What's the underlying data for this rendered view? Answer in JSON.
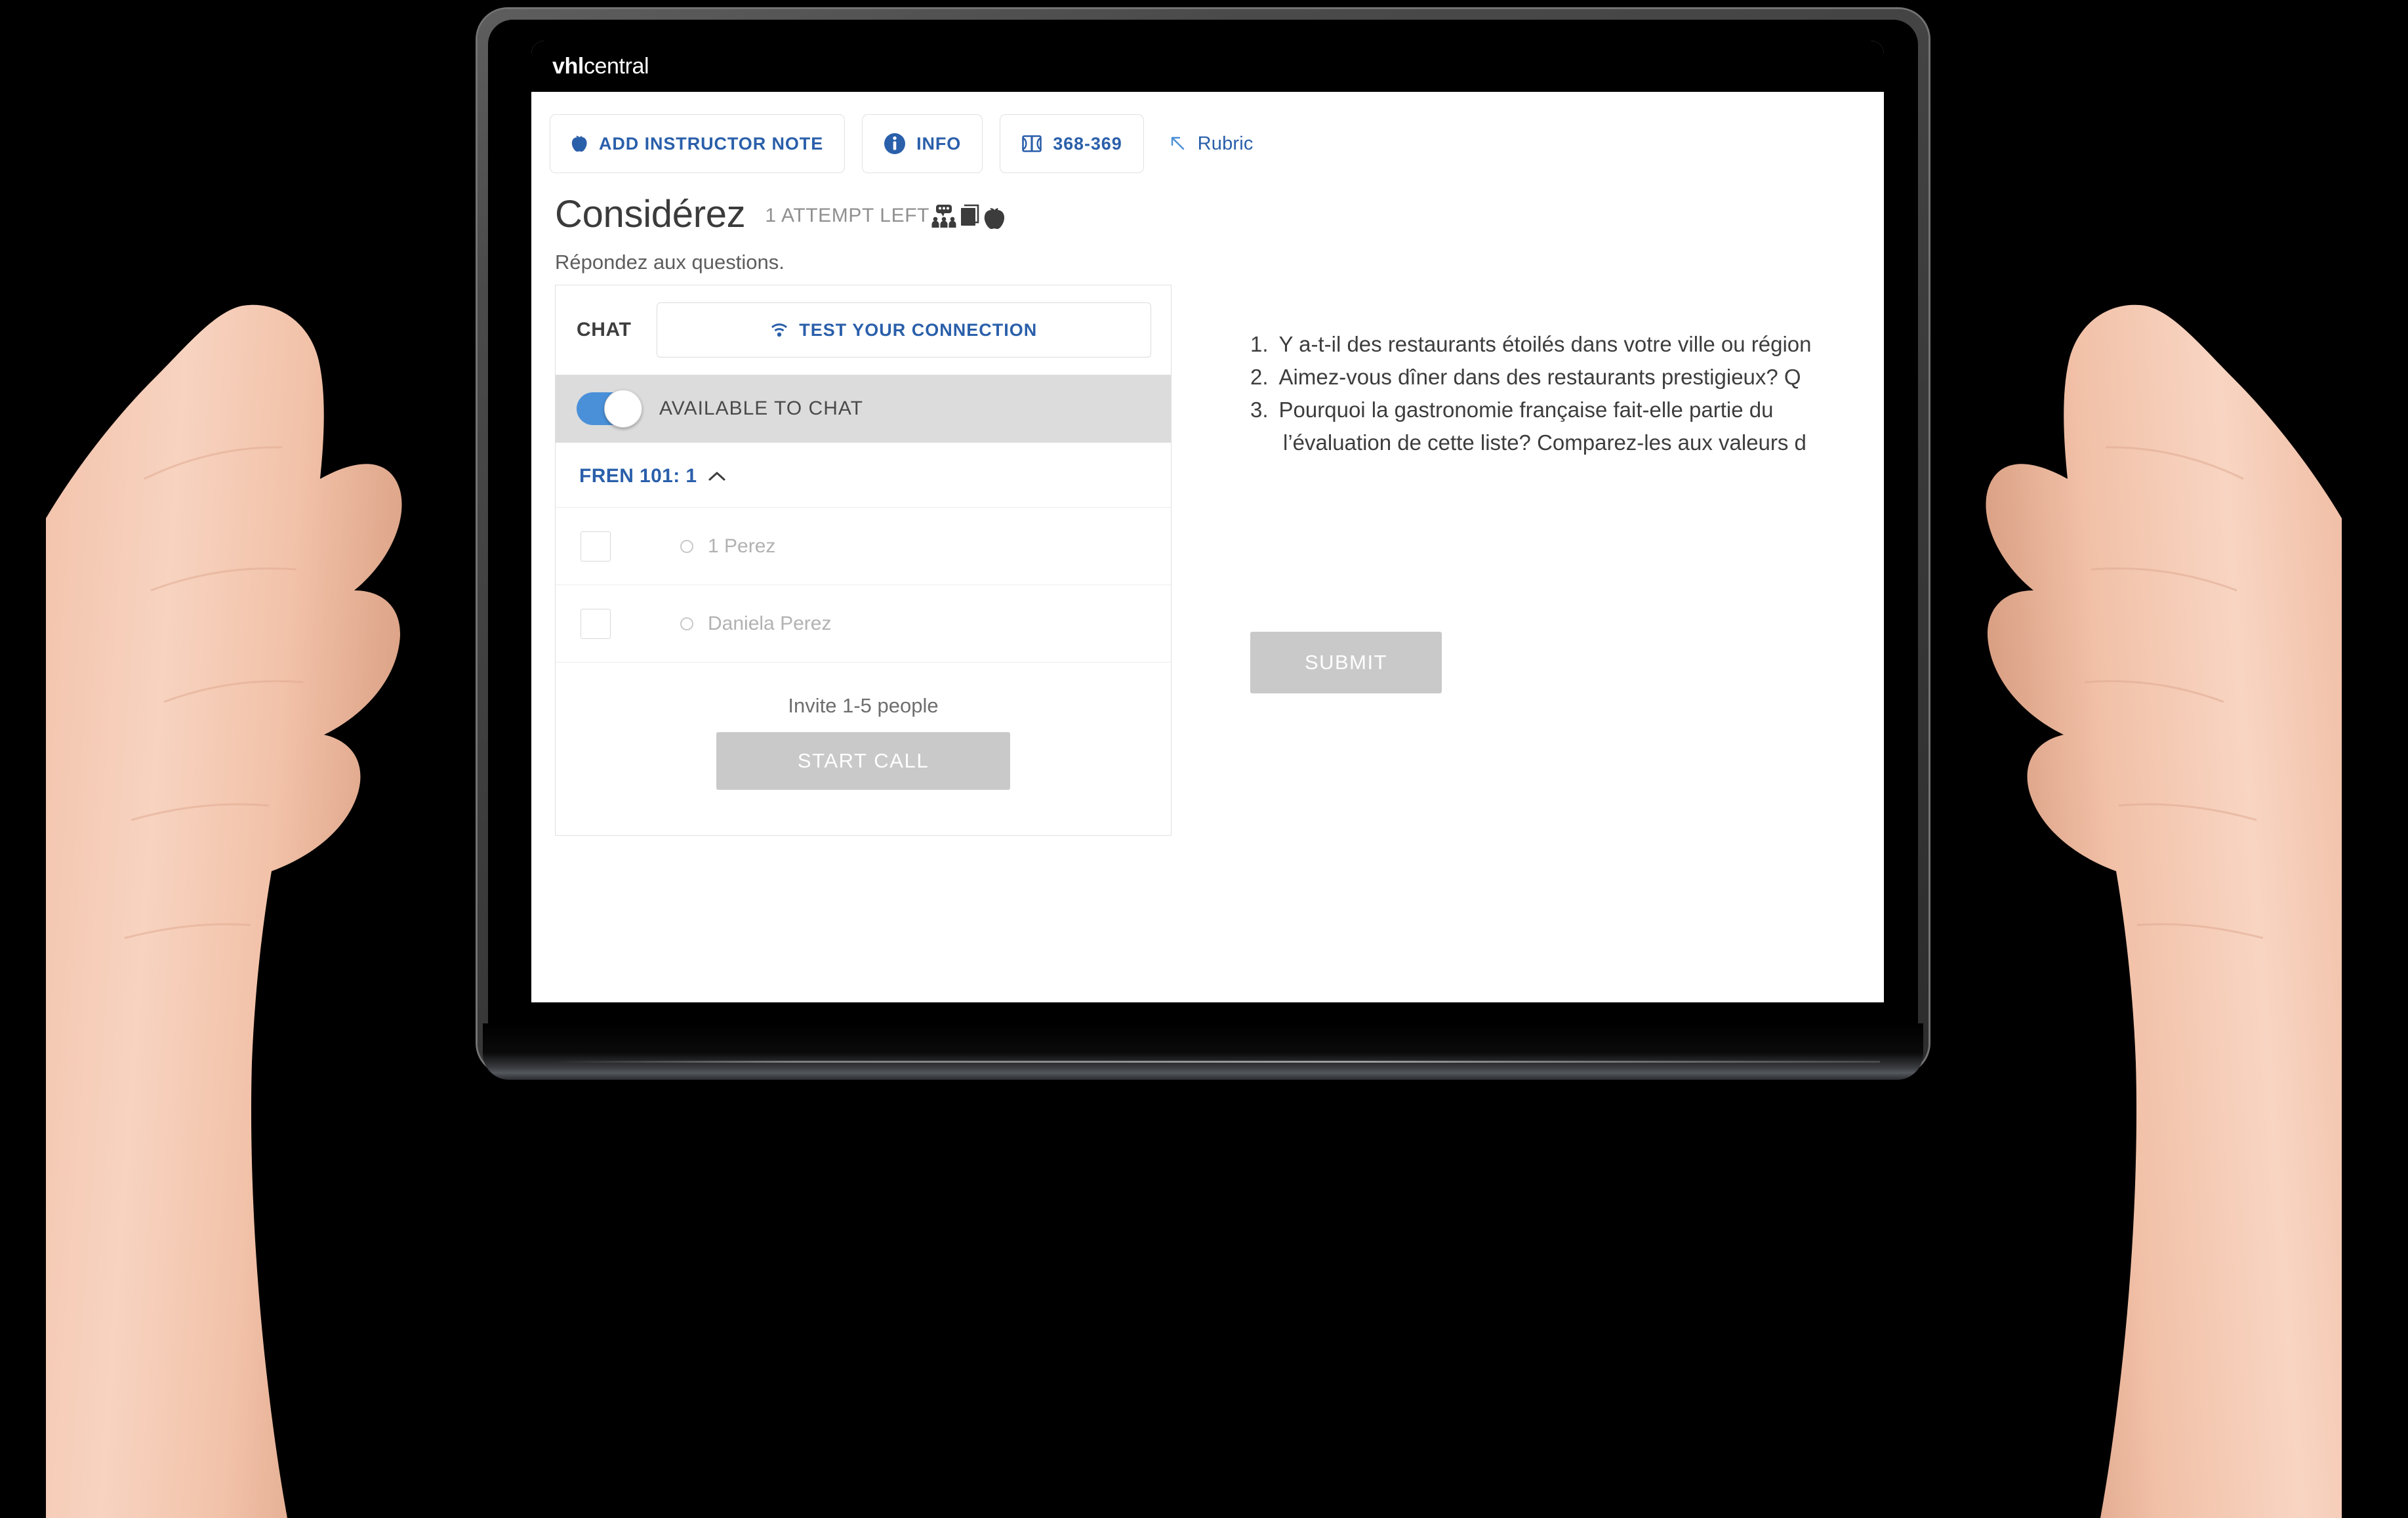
{
  "brand": {
    "bold": "vhl",
    "regular": "central"
  },
  "toolbar": {
    "buttons": [
      {
        "label": "ADD INSTRUCTOR NOTE",
        "icon": "apple-icon"
      },
      {
        "label": "INFO",
        "icon": "info-icon"
      },
      {
        "label": "368-369",
        "icon": "book-pages-icon"
      },
      {
        "label": "Rubric",
        "icon": "arrow-up-left-icon"
      }
    ]
  },
  "exercise": {
    "title": "Considérez",
    "attempts": "1 ATTEMPT LEFT",
    "status_icons": [
      "partner-chat-icon",
      "book-icon",
      "apple-icon"
    ],
    "direction": "Répondez aux questions."
  },
  "chat": {
    "title": "CHAT",
    "test_connection": "TEST YOUR CONNECTION",
    "test_connection_icon": "wifi-icon",
    "available_label": "AVAILABLE TO CHAT",
    "available_on": true,
    "course": "FREN 101: 1",
    "course_chevron": "chevron-up-icon",
    "participants": [
      {
        "name": "1 Perez",
        "checked": false,
        "status": "offline"
      },
      {
        "name": "Daniela Perez",
        "checked": false,
        "status": "offline"
      }
    ],
    "invite_hint": "Invite 1-5 people",
    "start_call": "START CALL"
  },
  "questions": {
    "items": [
      {
        "num": "1.",
        "text": "Y a-t-il des restaurants étoilés dans votre ville ou région"
      },
      {
        "num": "2.",
        "text": "Aimez-vous dîner dans des restaurants prestigieux? Q"
      },
      {
        "num": "3.",
        "text": "Pourquoi la gastronomie française fait-elle partie du",
        "cont": "l’évaluation de cette liste? Comparez-les aux valeurs d"
      }
    ],
    "submit": "SUBMIT"
  },
  "colors": {
    "accent_blue": "#2a5faa",
    "toggle_blue": "#4a90d9",
    "disabled_grey": "#c9c9c9",
    "app_bar_black": "#000000",
    "panel_grey": "#dcdcdc"
  }
}
